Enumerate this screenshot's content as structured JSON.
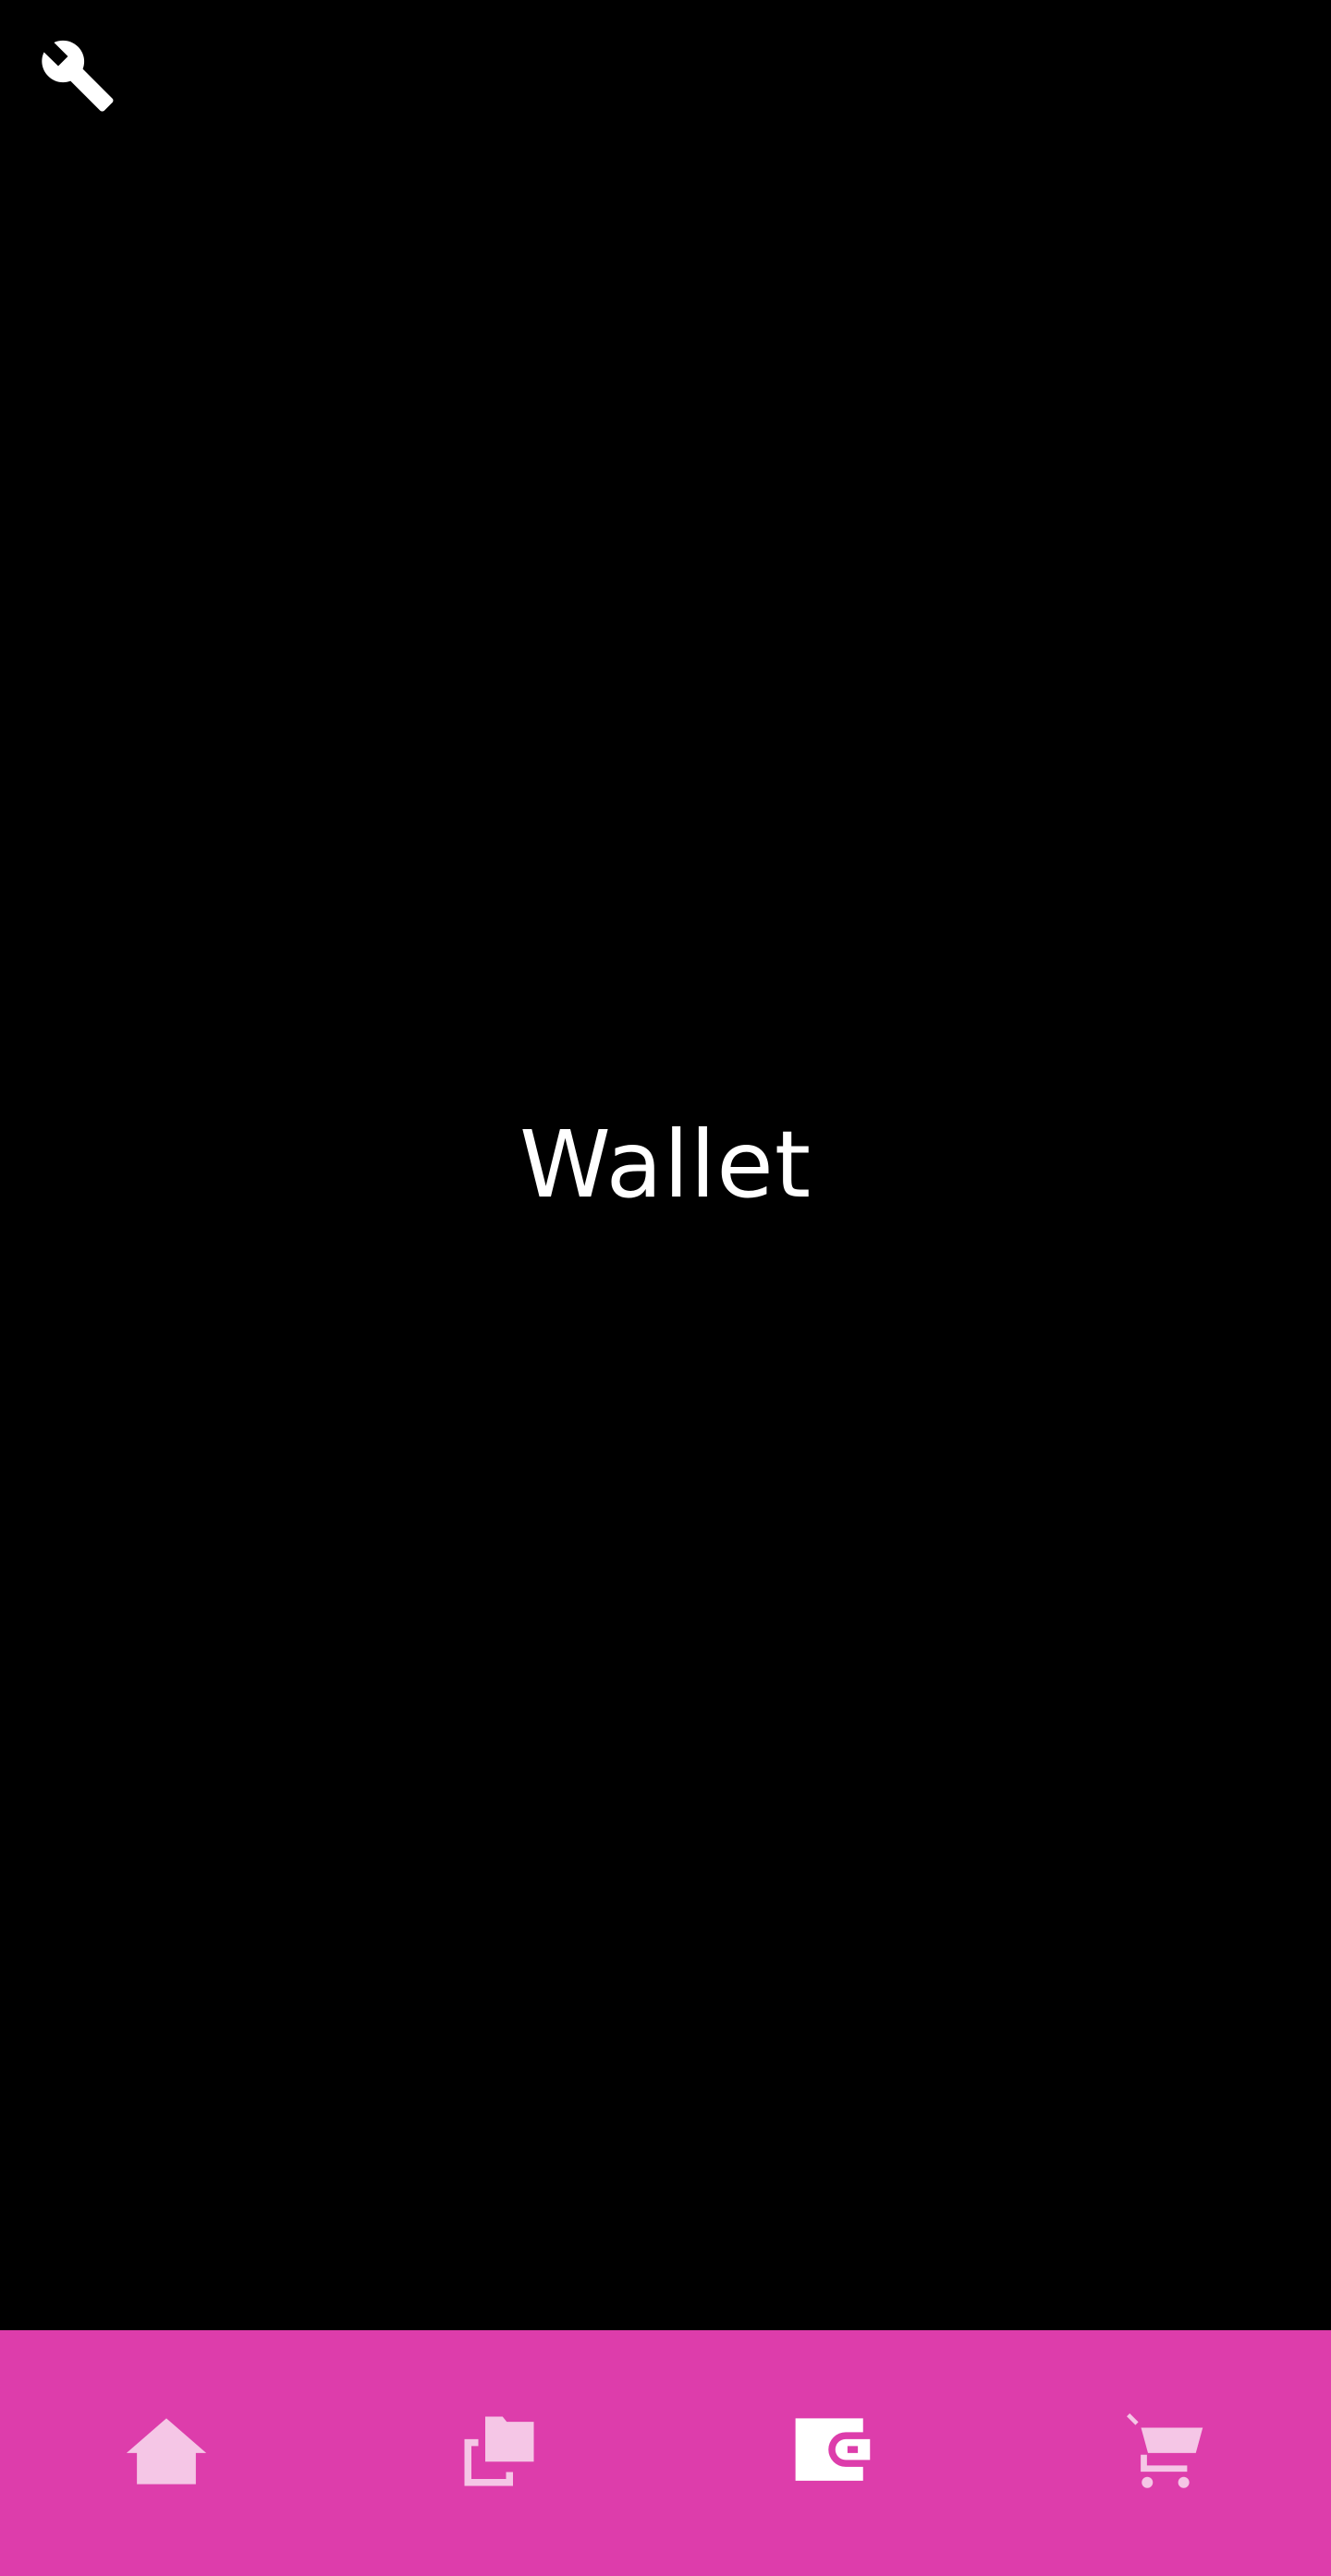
{
  "page": {
    "title": "Wallet"
  },
  "colors": {
    "background": "#000000",
    "nav_background": "#dd3dab",
    "icon_inactive": "#f5c6e6",
    "icon_active": "#ffffff",
    "title": "#ffffff"
  },
  "header": {
    "settings_icon": "wrench-icon"
  },
  "bottom_nav": {
    "items": [
      {
        "icon": "home-icon",
        "active": false
      },
      {
        "icon": "folders-icon",
        "active": false
      },
      {
        "icon": "wallet-icon",
        "active": true
      },
      {
        "icon": "cart-icon",
        "active": false
      }
    ]
  }
}
